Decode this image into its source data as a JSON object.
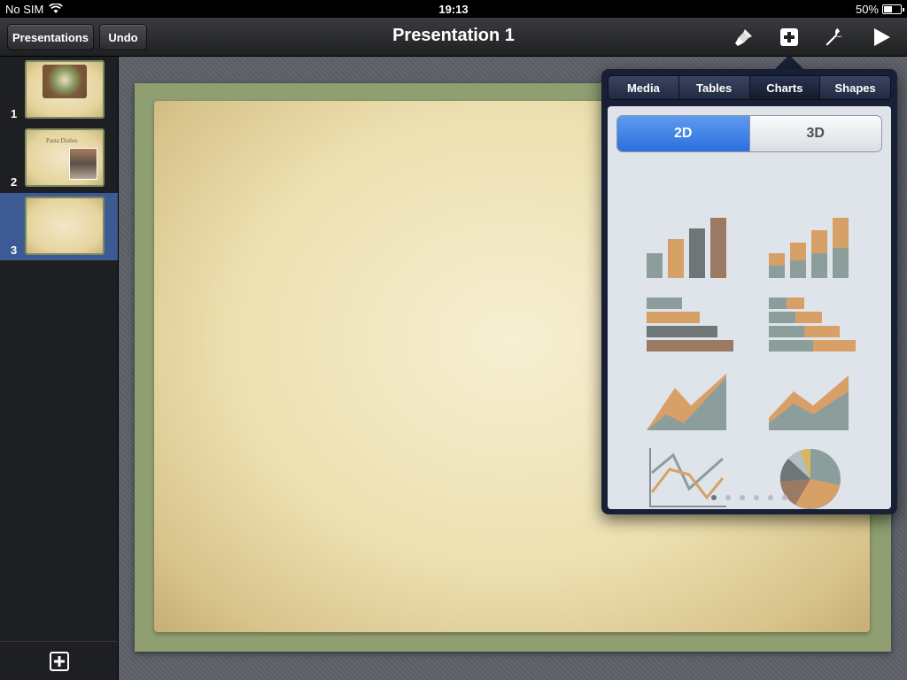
{
  "status_bar": {
    "carrier": "No SIM",
    "time": "19:13",
    "battery_percent": "50%",
    "battery_level": 0.5
  },
  "toolbar": {
    "presentations_label": "Presentations",
    "undo_label": "Undo",
    "title": "Presentation 1",
    "icons": [
      "paintbrush-icon",
      "insert-plus-icon",
      "wrench-icon",
      "play-icon"
    ]
  },
  "sidebar": {
    "slides": [
      {
        "number": "1"
      },
      {
        "number": "2",
        "text": "Pasta Dishes"
      },
      {
        "number": "3"
      }
    ],
    "selected_slide": "3"
  },
  "popover": {
    "tabs": [
      "Media",
      "Tables",
      "Charts",
      "Shapes"
    ],
    "active_tab": "Charts",
    "toggle": {
      "option_2d": "2D",
      "option_3d": "3D",
      "selected": "2D"
    },
    "chart_options": [
      "column-chart",
      "stacked-column-chart",
      "bar-chart",
      "stacked-bar-chart",
      "area-chart",
      "stacked-area-chart",
      "line-chart",
      "pie-chart"
    ],
    "page_count": 6,
    "current_page": 1
  },
  "colors": {
    "teal": "#8c9e9c",
    "orange": "#d7a067",
    "brown": "#9a7a62",
    "gray": "#6e7678",
    "yellow": "#d8b85c",
    "selection": "#3c5a93",
    "toggle_active": "#2b6fdd"
  }
}
